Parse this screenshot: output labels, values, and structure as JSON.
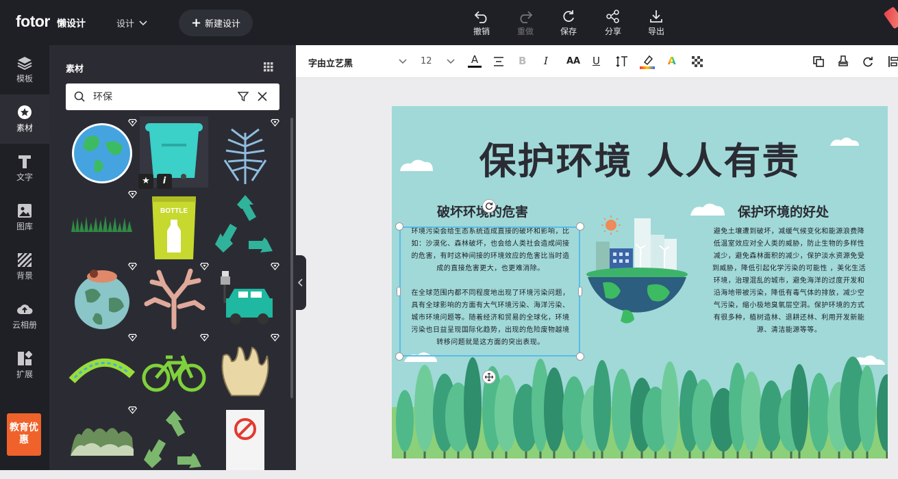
{
  "brand": {
    "logo": "fotor",
    "sub": "懒设计"
  },
  "topbar": {
    "design_menu": "设计",
    "new_design": "新建设计",
    "tools": [
      {
        "label": "撤销",
        "icon": "undo-icon",
        "enabled": true
      },
      {
        "label": "重做",
        "icon": "redo-icon",
        "enabled": false
      },
      {
        "label": "保存",
        "icon": "save-icon",
        "enabled": true
      },
      {
        "label": "分享",
        "icon": "share-icon",
        "enabled": true
      },
      {
        "label": "导出",
        "icon": "export-icon",
        "enabled": true
      }
    ]
  },
  "sidebar": {
    "items": [
      {
        "label": "模板",
        "icon": "layers-icon"
      },
      {
        "label": "素材",
        "icon": "star-icon",
        "active": true
      },
      {
        "label": "文字",
        "icon": "text-icon"
      },
      {
        "label": "图库",
        "icon": "image-icon"
      },
      {
        "label": "背景",
        "icon": "stripes-icon"
      },
      {
        "label": "云相册",
        "icon": "cloud-upload-icon"
      },
      {
        "label": "扩展",
        "icon": "apps-icon"
      }
    ],
    "edu_badge": "教育优惠"
  },
  "panel": {
    "title": "素材",
    "search_value": "环保",
    "assets": [
      {
        "name": "earth-globe",
        "vip": true
      },
      {
        "name": "teal-trash-bin",
        "vip": false
      },
      {
        "name": "blue-fern-plant",
        "vip": true
      },
      {
        "name": "grass-strip",
        "vip": true
      },
      {
        "name": "bottle-bin",
        "vip": false
      },
      {
        "name": "recycle-symbol-teal",
        "vip": false
      },
      {
        "name": "hugging-earth",
        "vip": true
      },
      {
        "name": "coral",
        "vip": true
      },
      {
        "name": "electric-car",
        "vip": true
      },
      {
        "name": "green-arc",
        "vip": true
      },
      {
        "name": "bicycle",
        "vip": true
      },
      {
        "name": "beige-coral",
        "vip": true
      },
      {
        "name": "bush-strip",
        "vip": true
      },
      {
        "name": "recycle-symbol-green",
        "vip": false
      },
      {
        "name": "no-sign-card",
        "vip": false
      }
    ],
    "bottle_label": "BOTTLE"
  },
  "textbar": {
    "font": "字由立艺黑",
    "size": "12"
  },
  "poster": {
    "title": "保护环境  人人有责",
    "left_title": "破坏环境的危害",
    "right_title": "保护环境的好处",
    "left_text_1": "环境污染会给生态系统造成直接的破坏和影响，比如：沙漠化、森林破坏，也会给人类社会造成间接的危害，有时这种间接的环境效应的危害比当时造成的直接危害更大，也更难消除。",
    "left_text_2": "在全球范围内都不同程度地出现了环境污染问题，具有全球影响的方面有大气环境污染、海洋污染、城市环境问题等。随着经济和贸易的全球化，环境污染也日益呈现国际化趋势，出现的危险废物越境转移问题就是这方面的突出表现。",
    "right_text": "避免土壤遭到破坏，减缓气候变化和能源浪费降低温室效应对全人类的威胁，防止生物的多样性减少，避免森林面积的减少，保护淡水资源免受到威胁，降低引起化学污染的可能性 ，美化生活环境，治理混乱的城市，避免海洋的过度开发和沿海地带被污染，降低有毒气体的排放，减少空气污染，缩小极地臭氧层空洞。保护环境的方式有很多种，植树造林、退耕还林、利用开发新能源、清洁能源等等。"
  },
  "colors": {
    "accent": "#5bbbe8",
    "dark": "#1f2026",
    "poster_bg": "#a0d9d8",
    "badge": "#f0622b"
  }
}
